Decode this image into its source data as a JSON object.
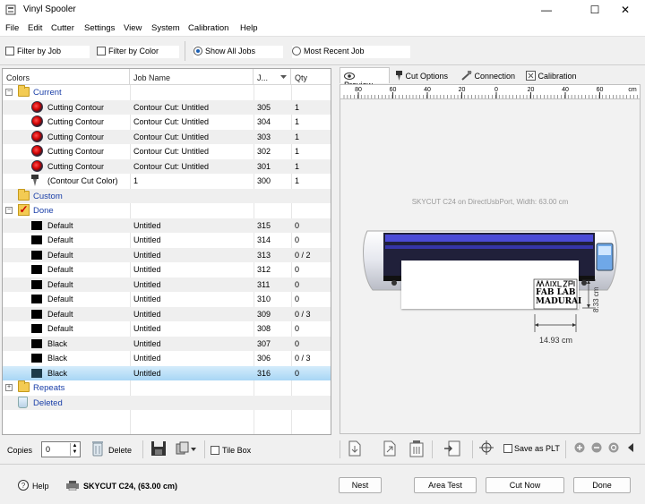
{
  "window": {
    "title": "Vinyl Spooler",
    "min": "—",
    "max": "☐",
    "close": "✕"
  },
  "menu": [
    "File",
    "Edit",
    "Cutter",
    "Settings",
    "View",
    "System",
    "Calibration",
    "Help"
  ],
  "filters": {
    "by_job": {
      "label": "Filter by Job",
      "checked": false
    },
    "by_color": {
      "label": "Filter by Color",
      "checked": false
    },
    "show_all": {
      "label": "Show All Jobs",
      "selected": true
    },
    "most_recent": {
      "label": "Most Recent Job",
      "selected": false
    }
  },
  "table": {
    "headers": [
      "Colors",
      "Job Name",
      "J...",
      "Qty"
    ],
    "groups": {
      "current": "Current",
      "custom": "Custom",
      "done": "Done",
      "repeats": "Repeats",
      "deleted": "Deleted"
    },
    "current_rows": [
      {
        "color": "Cutting Contour",
        "job": "Contour Cut: Untitled",
        "j": "305",
        "qty": "1"
      },
      {
        "color": "Cutting Contour",
        "job": "Contour Cut: Untitled",
        "j": "304",
        "qty": "1"
      },
      {
        "color": "Cutting Contour",
        "job": "Contour Cut: Untitled",
        "j": "303",
        "qty": "1"
      },
      {
        "color": "Cutting Contour",
        "job": "Contour Cut: Untitled",
        "j": "302",
        "qty": "1"
      },
      {
        "color": "Cutting Contour",
        "job": "Contour Cut: Untitled",
        "j": "301",
        "qty": "1"
      },
      {
        "color": "(Contour Cut Color)",
        "job": "1",
        "j": "300",
        "qty": "1"
      }
    ],
    "done_rows": [
      {
        "color": "Default",
        "job": "Untitled",
        "j": "315",
        "qty": "0"
      },
      {
        "color": "Default",
        "job": "Untitled",
        "j": "314",
        "qty": "0"
      },
      {
        "color": "Default",
        "job": "Untitled",
        "j": "313",
        "qty": "0 / 2"
      },
      {
        "color": "Default",
        "job": "Untitled",
        "j": "312",
        "qty": "0"
      },
      {
        "color": "Default",
        "job": "Untitled",
        "j": "311",
        "qty": "0"
      },
      {
        "color": "Default",
        "job": "Untitled",
        "j": "310",
        "qty": "0"
      },
      {
        "color": "Default",
        "job": "Untitled",
        "j": "309",
        "qty": "0 / 3"
      },
      {
        "color": "Default",
        "job": "Untitled",
        "j": "308",
        "qty": "0"
      },
      {
        "color": "Black",
        "job": "Untitled",
        "j": "307",
        "qty": "0"
      },
      {
        "color": "Black",
        "job": "Untitled",
        "j": "306",
        "qty": "0 / 3"
      },
      {
        "color": "Black",
        "job": "Untitled",
        "j": "316",
        "qty": "0"
      }
    ]
  },
  "left_toolbar": {
    "copies_label": "Copies",
    "copies_value": "0",
    "delete_label": "Delete",
    "tile_box_label": "Tile Box"
  },
  "tabs": [
    "Preview",
    "Cut Options",
    "Connection",
    "Calibration"
  ],
  "ruler": {
    "labels": [
      "80",
      "60",
      "40",
      "20",
      "0",
      "20",
      "40",
      "60"
    ],
    "unit": "cm"
  },
  "preview": {
    "cutter_text": "SKYCUT C24 on DirectUsbPort,   Width: 63.00 cm",
    "design_line1": "FAB LAB",
    "design_line2": "MADURAI",
    "width_dim": "14.93 cm",
    "height_dim": "8.33 cm"
  },
  "right_toolbar": {
    "save_as_plt_label": "Save as PLT"
  },
  "status": {
    "help_label": "Help",
    "device_label": "SKYCUT C24,  (63.00 cm)",
    "nest_label": "Nest",
    "area_test_label": "Area Test",
    "cut_now_label": "Cut Now",
    "done_label": "Done"
  }
}
